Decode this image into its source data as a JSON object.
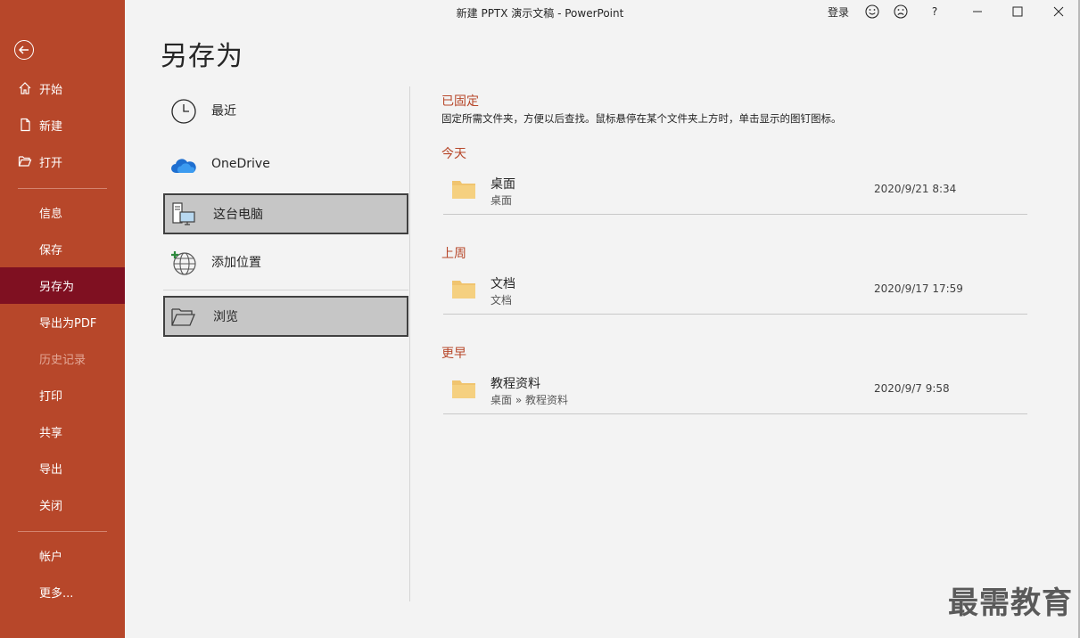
{
  "window": {
    "title": "新建 PPTX 演示文稿  -  PowerPoint",
    "signin": "登录",
    "help": "?",
    "minimize": "−",
    "maximize": "☐",
    "close": "✕"
  },
  "sidebar": {
    "items": [
      {
        "label": "开始",
        "icon": "home-icon"
      },
      {
        "label": "新建",
        "icon": "new-file-icon"
      },
      {
        "label": "打开",
        "icon": "open-folder-icon"
      },
      {
        "label": "信息"
      },
      {
        "label": "保存"
      },
      {
        "label": "另存为",
        "active": true
      },
      {
        "label": "导出为PDF"
      },
      {
        "label": "历史记录",
        "disabled": true
      },
      {
        "label": "打印"
      },
      {
        "label": "共享"
      },
      {
        "label": "导出"
      },
      {
        "label": "关闭"
      },
      {
        "label": "帐户"
      },
      {
        "label": "更多..."
      }
    ]
  },
  "page": {
    "title": "另存为"
  },
  "locations": [
    {
      "label": "最近",
      "icon": "clock-icon"
    },
    {
      "label": "OneDrive",
      "icon": "onedrive-cloud-icon"
    },
    {
      "label": "这台电脑",
      "icon": "this-pc-icon",
      "selected": true
    },
    {
      "label": "添加位置",
      "icon": "add-location-globe-icon"
    },
    {
      "label": "浏览",
      "icon": "browse-folder-icon",
      "selected": true
    }
  ],
  "pinned": {
    "heading": "已固定",
    "description": "固定所需文件夹，方便以后查找。鼠标悬停在某个文件夹上方时，单击显示的图钉图标。"
  },
  "groups": [
    {
      "heading": "今天",
      "folder": {
        "name": "桌面",
        "path": "桌面",
        "date": "2020/9/21 8:34"
      }
    },
    {
      "heading": "上周",
      "folder": {
        "name": "文档",
        "path": "文档",
        "date": "2020/9/17 17:59"
      }
    },
    {
      "heading": "更早",
      "folder": {
        "name": "教程资料",
        "path": "桌面 » 教程资料",
        "date": "2020/9/7 9:58"
      }
    }
  ],
  "watermark": "最需教育",
  "colors": {
    "accent": "#b7472a",
    "active": "#7f1021",
    "folder": "#f0c46f"
  }
}
